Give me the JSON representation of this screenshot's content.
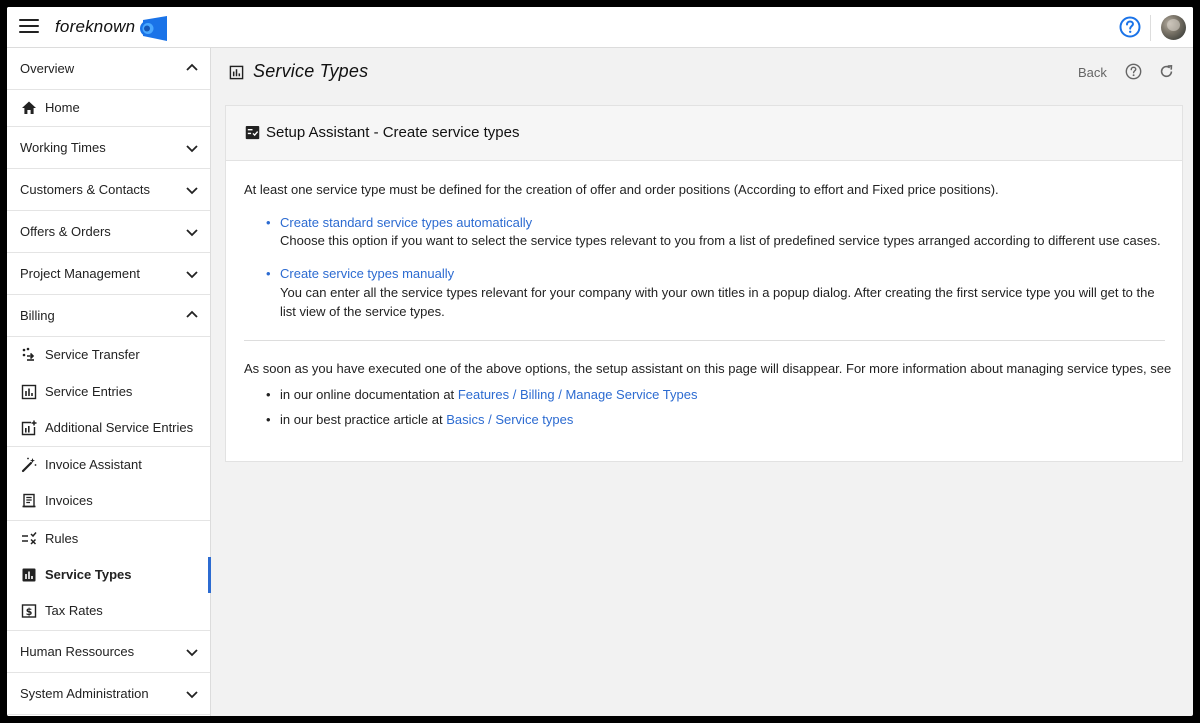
{
  "app": {
    "brand": "foreknown"
  },
  "header": {
    "help_icon": "help-circle-icon",
    "avatar": "user-avatar"
  },
  "sidebar": {
    "sections": [
      {
        "label": "Overview",
        "expanded": true
      },
      {
        "label": "Working Times",
        "expanded": false
      },
      {
        "label": "Customers & Contacts",
        "expanded": false
      },
      {
        "label": "Offers & Orders",
        "expanded": false
      },
      {
        "label": "Project Management",
        "expanded": false
      },
      {
        "label": "Billing",
        "expanded": true
      },
      {
        "label": "Human Ressources",
        "expanded": false
      },
      {
        "label": "System Administration",
        "expanded": false
      }
    ],
    "overview_items": [
      {
        "label": "Home",
        "icon": "home-icon"
      }
    ],
    "billing_items": [
      {
        "label": "Service Transfer",
        "icon": "transfer-icon"
      },
      {
        "label": "Service Entries",
        "icon": "bar-chart-icon"
      },
      {
        "label": "Additional Service Entries",
        "icon": "add-chart-icon"
      },
      {
        "label": "Invoice Assistant",
        "icon": "magic-wand-icon"
      },
      {
        "label": "Invoices",
        "icon": "receipt-icon"
      },
      {
        "label": "Rules",
        "icon": "rules-icon"
      },
      {
        "label": "Service Types",
        "icon": "bar-chart-filled-icon",
        "active": true
      },
      {
        "label": "Tax Rates",
        "icon": "dollar-box-icon"
      }
    ]
  },
  "page": {
    "title": "Service Types",
    "back_label": "Back"
  },
  "assistant": {
    "title": "Setup Assistant - Create service types",
    "intro": "At least one service type must be defined for the creation of offer and order positions (According to effort and Fixed price positions).",
    "option1_link": "Create standard service types automatically",
    "option1_desc": "Choose this option if you want to select the service types relevant to you from a list of predefined service types arranged according to different use cases.",
    "option2_link": "Create service types manually",
    "option2_desc": "You can enter all the service types relevant for your company with your own titles in a popup dialog. After creating the first service type you will get to the list view of the service types.",
    "more_info": "As soon as you have executed one of the above options, the setup assistant on this page will disappear. For more information about managing service types, see",
    "ref1_prefix": "in our online documentation at",
    "ref1_link": "Features / Billing / Manage Service Types",
    "ref2_prefix": "in our best practice article at",
    "ref2_link": "Basics / Service types"
  },
  "colors": {
    "accent": "#2c6bd1",
    "logo_blue": "#1a73e8"
  }
}
